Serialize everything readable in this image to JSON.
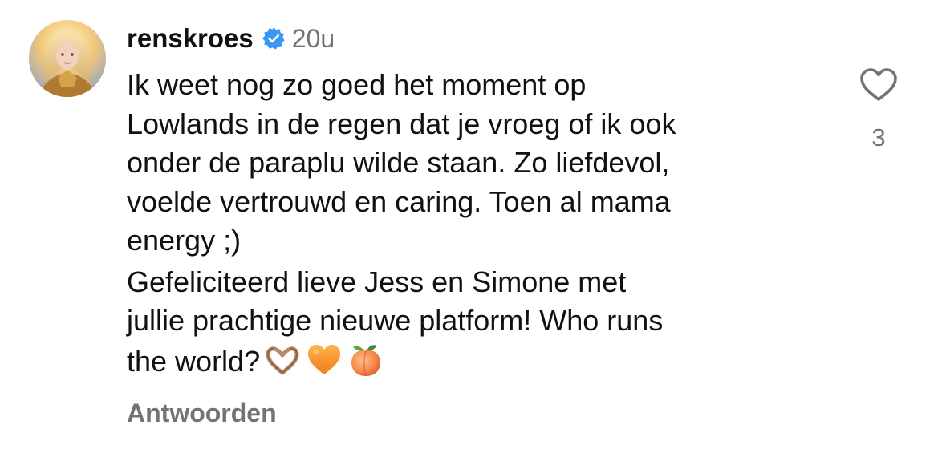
{
  "comment": {
    "username": "renskroes",
    "verified_icon": "verified-badge-icon",
    "time": "20u",
    "paragraph_1": "Ik weet nog zo goed het moment op\nLowlands in de regen dat je vroeg of ik ook\nonder de paraplu wilde staan. Zo liefdevol,\nvoelde vertrouwd en caring. Toen al mama\nenergy ;)",
    "paragraph_2": "Gefeliciteerd lieve Jess  en Simone met\njullie prachtige nieuwe platform! Who runs\nthe world?",
    "emojis": [
      "heart-hands-emoji",
      "orange-heart-emoji",
      "peach-emoji"
    ],
    "reply_label": "Antwoorden",
    "like_icon": "heart-outline-icon",
    "like_count": "3"
  },
  "colors": {
    "text": "#111111",
    "secondary": "#737373",
    "verified_blue": "#3897f0"
  }
}
